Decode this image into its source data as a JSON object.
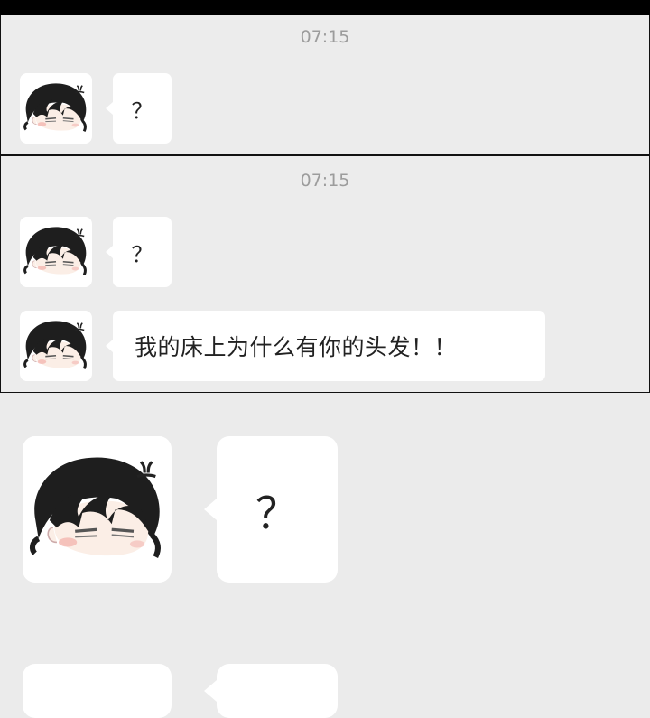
{
  "panel1": {
    "timestamp": "07:15",
    "messages": [
      {
        "text": "？"
      }
    ]
  },
  "panel2": {
    "timestamp": "07:15",
    "messages": [
      {
        "text": "？"
      },
      {
        "text": "我的床上为什么有你的头发！！"
      }
    ]
  },
  "panel3": {
    "messages": [
      {
        "text": "？"
      }
    ]
  },
  "icons": {
    "avatar": "avatar-icon",
    "anger_mark": "anger-mark-icon"
  },
  "colors": {
    "background": "#ebebeb",
    "bubble": "#ffffff",
    "timestamp": "#9c9c9c",
    "border": "#111111"
  }
}
